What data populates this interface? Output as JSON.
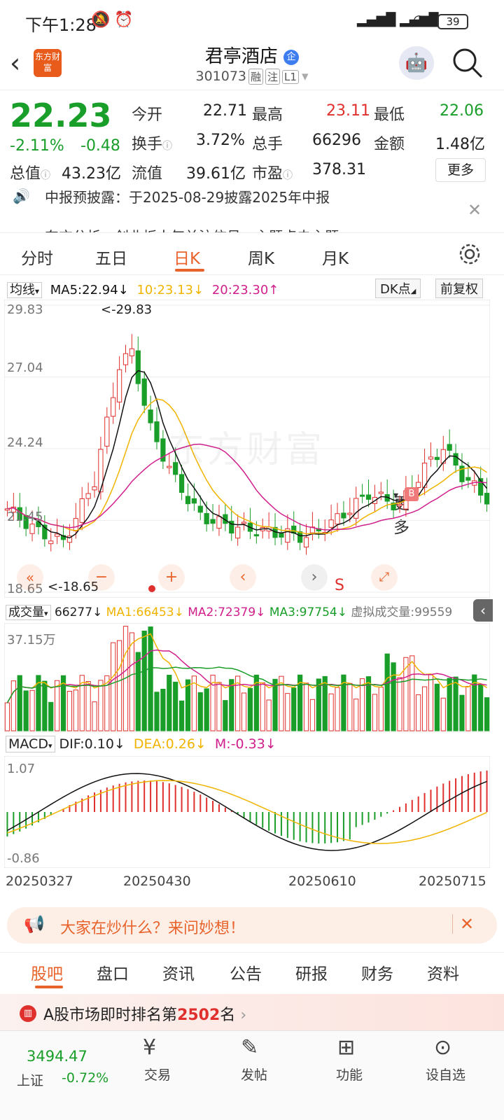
{
  "status": {
    "time": "下午1:28",
    "battery": "39"
  },
  "header": {
    "title": "君亭酒店",
    "code": "301073",
    "tags": [
      "融",
      "注",
      "L1"
    ],
    "logo_text": "东方财富"
  },
  "quote": {
    "price": "22.23",
    "change_pct": "-2.11%",
    "change": "-0.48",
    "fields": [
      {
        "label": "今开",
        "value": "22.71"
      },
      {
        "label": "最高",
        "value": "23.11"
      },
      {
        "label": "最低",
        "value": "22.06"
      },
      {
        "label": "换手",
        "value": "3.72%"
      },
      {
        "label": "总手",
        "value": "66296"
      },
      {
        "label": "金额",
        "value": "1.48亿"
      },
      {
        "label": "总值",
        "value": "43.23亿"
      },
      {
        "label": "流值",
        "value": "39.61亿"
      },
      {
        "label": "市盈",
        "value": "378.31"
      }
    ],
    "more": "更多"
  },
  "notice": {
    "line1": "中报预披露：于2025-08-29披露2025年中报",
    "line2": "东方分析：创业板人气关注信号，主题点击主题"
  },
  "tabs": [
    "分时",
    "五日",
    "日K",
    "周K",
    "月K",
    "更多"
  ],
  "chart_bar": {
    "ma_type": "均线",
    "ma5": "MA5:22.94↓",
    "ma10": "10:23.13↓",
    "ma20": "20:23.30↑",
    "dk": "DK点",
    "adjust": "前复权"
  },
  "kchart": {
    "ymax": "29.83",
    "y2": "27.04",
    "y3": "24.24",
    "y4": "21.45",
    "ymin": "18.65",
    "high_label": "<-29.83",
    "low_label": "<-18.65",
    "watermark": "东方财富",
    "sell_mark": "S",
    "buy_mark": "B"
  },
  "volume": {
    "label": "成交量",
    "v": "66277↓",
    "ma1": "MA1:66453↓",
    "ma2": "MA2:72379↓",
    "ma3": "MA3:97754↓",
    "virtual": "虚拟成交量:99559",
    "ymax": "37.15万"
  },
  "macd": {
    "label": "MACD",
    "dif": "DIF:0.10↓",
    "dea": "DEA:0.26↓",
    "m": "M:-0.33↓",
    "ymax": "1.07",
    "ymin": "-0.86"
  },
  "dates": [
    "20250327",
    "20250430",
    "20250610",
    "20250715"
  ],
  "ask": {
    "text": "大家在炒什么？来问妙想！"
  },
  "bottom_tabs": [
    "股吧",
    "盘口",
    "资讯",
    "公告",
    "研报",
    "财务",
    "资料"
  ],
  "rank": {
    "prefix": "A股市场即时排名第",
    "num": "2502",
    "suffix": "名"
  },
  "nav": {
    "index_value": "3494.47",
    "index_name": "上证",
    "index_pct": "-0.72%",
    "items": [
      "交易",
      "发帖",
      "功能",
      "设自选"
    ]
  },
  "colors": {
    "up": "#e0302e",
    "down": "#1a9e2a",
    "accent": "#e8632b",
    "ma5": "#111111",
    "ma10": "#f0b400",
    "ma20": "#d0208c"
  }
}
